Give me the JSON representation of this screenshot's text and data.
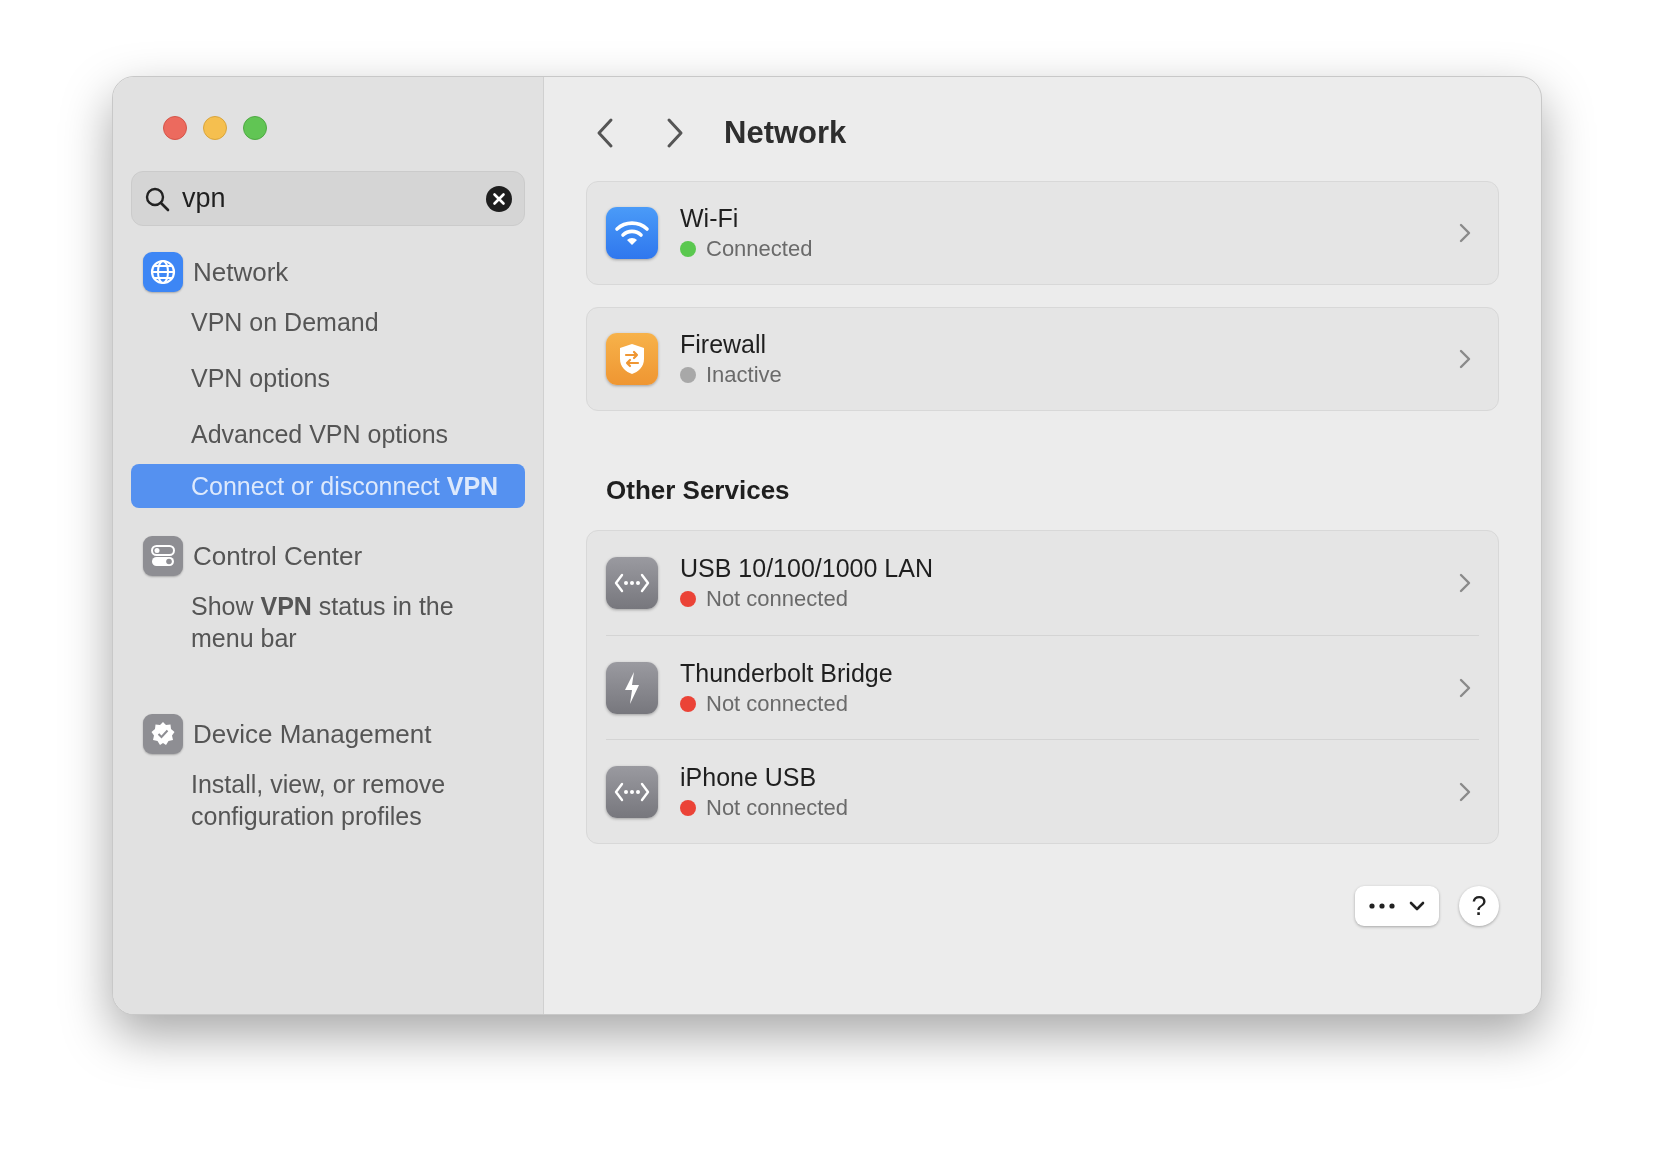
{
  "search": {
    "value": "vpn"
  },
  "sidebar": {
    "groups": [
      {
        "kind": "network",
        "title": "Network",
        "items": [
          {
            "label": "VPN on Demand",
            "selected": false
          },
          {
            "label": "VPN options",
            "selected": false
          },
          {
            "label": "Advanced VPN options",
            "selected": false
          },
          {
            "label": "Connect or disconnect **VPN**",
            "selected": true
          }
        ]
      },
      {
        "kind": "control",
        "title": "Control Center",
        "items": [
          {
            "label": "Show **VPN** status in the menu bar",
            "selected": false
          }
        ]
      },
      {
        "kind": "device",
        "title": "Device Management",
        "items": [
          {
            "label": "Install, view, or remove configuration profiles",
            "selected": false
          }
        ]
      }
    ]
  },
  "header": {
    "title": "Network"
  },
  "cards": [
    {
      "kind": "wifi",
      "name": "Wi-Fi",
      "status": "Connected",
      "color": "#5ac84f"
    },
    {
      "kind": "firewall",
      "name": "Firewall",
      "status": "Inactive",
      "color": "#a8a8a8"
    }
  ],
  "other_services": {
    "title": "Other Services",
    "rows": [
      {
        "kind": "ethernet",
        "name": "USB 10/100/1000 LAN",
        "status": "Not connected",
        "color": "#eb4337"
      },
      {
        "kind": "thunderbolt",
        "name": "Thunderbolt Bridge",
        "status": "Not connected",
        "color": "#eb4337"
      },
      {
        "kind": "ethernet",
        "name": "iPhone USB",
        "status": "Not connected",
        "color": "#eb4337"
      }
    ]
  },
  "footer": {
    "help": "?"
  }
}
